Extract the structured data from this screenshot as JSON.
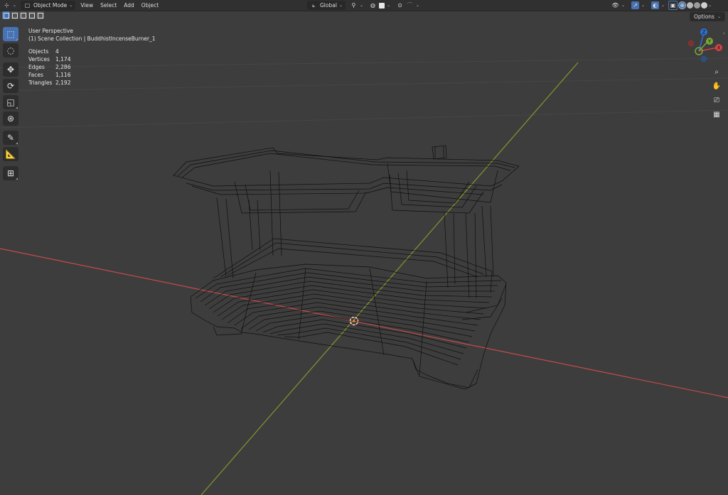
{
  "header": {
    "editor_type_icon": "3d-viewport-icon",
    "mode_label": "Object Mode",
    "menus": [
      "View",
      "Select",
      "Add",
      "Object"
    ],
    "transform_orientation": "Global"
  },
  "overlay": {
    "view_name": "User Perspective",
    "collection_line": "(1) Scene Collection | BuddhistIncenseBurner_1"
  },
  "stats": [
    {
      "label": "Objects",
      "value": "4"
    },
    {
      "label": "Vertices",
      "value": "1,174"
    },
    {
      "label": "Edges",
      "value": "2,286"
    },
    {
      "label": "Faces",
      "value": "1,116"
    },
    {
      "label": "Triangles",
      "value": "2,192"
    }
  ],
  "options_label": "Options",
  "gizmo": {
    "z": "Z",
    "y": "Y",
    "x": "X"
  },
  "tools": [
    "select-box-icon",
    "cursor-icon",
    "move-icon",
    "rotate-icon",
    "scale-icon",
    "transform-icon",
    "annotate-icon",
    "measure-icon",
    "add-cube-icon"
  ],
  "colors": {
    "x_axis": "#c84a4a",
    "y_axis": "#7f9a2c",
    "active_blue": "#4772b3",
    "background": "#3d3d3d",
    "wire": "#0e0e0e"
  }
}
